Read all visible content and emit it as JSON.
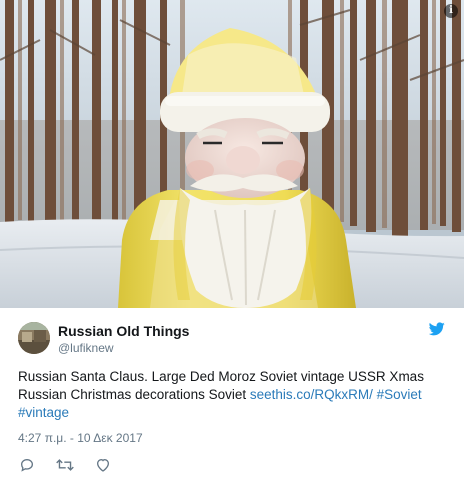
{
  "media": {
    "info_glyph": "i",
    "info_icon": "info-icon"
  },
  "author": {
    "display_name": "Russian Old Things",
    "handle": "@lufiknew",
    "avatar_icon": "avatar"
  },
  "brand": {
    "icon": "twitter-bird-icon",
    "color": "#1da1f2"
  },
  "tweet": {
    "text_before_link": "Russian Santa Claus. Large Ded Moroz Soviet vintage USSR Xmas Russian Christmas decorations Soviet ",
    "link": "seethis.co/RQkxRM/",
    "hashtag_1": "#Soviet",
    "hashtag_2": "#vintage",
    "link_color": "#2b7bb9"
  },
  "meta": {
    "timestamp": "4:27 π.μ. - 10 Δεκ 2017"
  },
  "actions": [
    {
      "name": "reply",
      "icon": "reply-icon"
    },
    {
      "name": "retweet",
      "icon": "retweet-icon"
    },
    {
      "name": "like",
      "icon": "heart-icon"
    }
  ]
}
